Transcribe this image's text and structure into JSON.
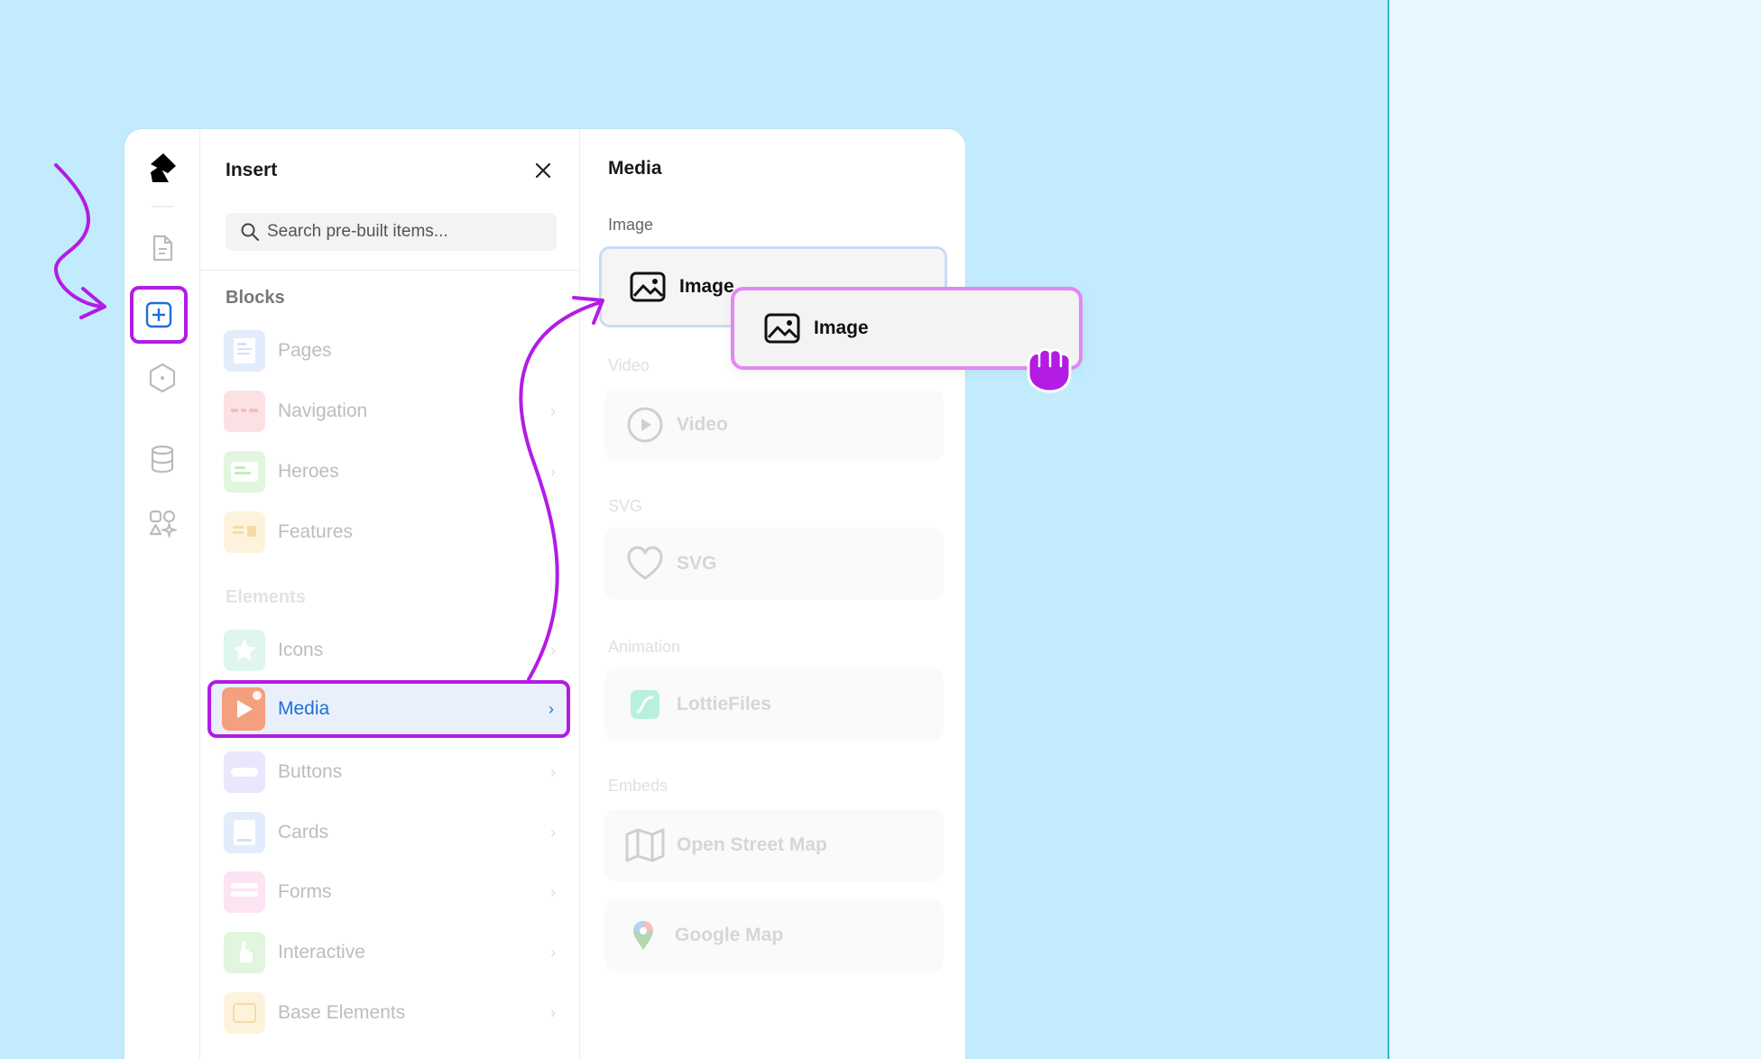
{
  "colors": {
    "accent": "#b21ce4",
    "primary_blue": "#1f6fd8",
    "canvas_bg": "#c2ecfd"
  },
  "rail": {
    "items": [
      {
        "name": "logo",
        "icon": "framer-logo-icon"
      },
      {
        "name": "pages",
        "icon": "page-icon"
      },
      {
        "name": "insert",
        "icon": "plus-square-icon",
        "active": true
      },
      {
        "name": "components",
        "icon": "hexagon-icon"
      },
      {
        "name": "cms",
        "icon": "database-icon"
      },
      {
        "name": "assets",
        "icon": "shapes-icon"
      }
    ]
  },
  "insert": {
    "title": "Insert",
    "search_placeholder": "Search pre-built items...",
    "blocks_title": "Blocks",
    "blocks": [
      {
        "label": "Pages",
        "chevron": false,
        "color": "#e3ecfb"
      },
      {
        "label": "Navigation",
        "chevron": true,
        "color": "#fce1e4"
      },
      {
        "label": "Heroes",
        "chevron": true,
        "color": "#e2f5de"
      },
      {
        "label": "Features",
        "chevron": true,
        "color": "#fdf3dc"
      }
    ],
    "elements_title": "Elements",
    "elements": [
      {
        "label": "Icons",
        "chevron": true,
        "color": "#dff6ec"
      },
      {
        "label": "Media",
        "chevron": true,
        "selected": true
      },
      {
        "label": "Buttons",
        "chevron": true,
        "color": "#eae6fb"
      },
      {
        "label": "Cards",
        "chevron": true,
        "color": "#e3ecfb"
      },
      {
        "label": "Forms",
        "chevron": true,
        "color": "#fde4f2"
      },
      {
        "label": "Interactive",
        "chevron": true,
        "color": "#e2f5de"
      },
      {
        "label": "Base Elements",
        "chevron": true,
        "color": "#fdf3dc"
      }
    ]
  },
  "media": {
    "title": "Media",
    "sections": [
      {
        "category": "Image",
        "item": "Image",
        "icon": "image-icon"
      },
      {
        "category": "Video",
        "item": "Video",
        "icon": "play-circle-icon"
      },
      {
        "category": "SVG",
        "item": "SVG",
        "icon": "heart-icon"
      },
      {
        "category": "Animation",
        "item": "LottieFiles",
        "icon": "lottie-icon"
      },
      {
        "category": "Embeds",
        "item": "Open Street Map",
        "icon": "map-icon"
      },
      {
        "category": "",
        "item": "Google Map",
        "icon": "map-pin-icon"
      }
    ]
  },
  "drag": {
    "label": "Image",
    "icon": "image-icon",
    "cursor": "grab-hand-icon"
  }
}
